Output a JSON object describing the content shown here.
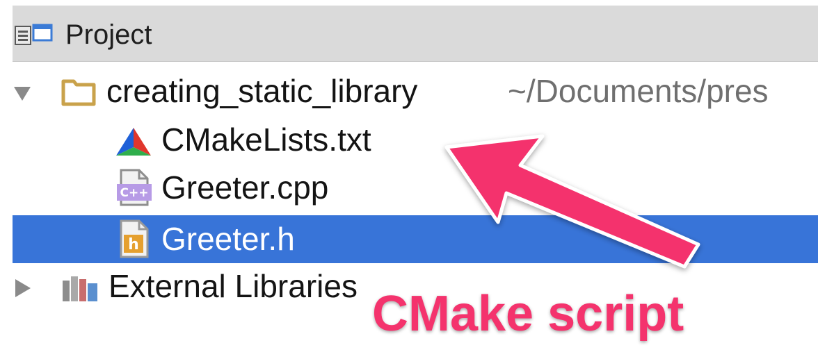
{
  "toolbar": {
    "title": "Project",
    "icon": "project-window-icon"
  },
  "tree": {
    "root": {
      "name": "creating_static_library",
      "path": "~/Documents/pres",
      "expanded": true,
      "icon": "folder-icon"
    },
    "files": [
      {
        "name": "CMakeLists.txt",
        "icon": "cmake-icon",
        "selected": false
      },
      {
        "name": "Greeter.cpp",
        "icon": "cpp-file-icon",
        "selected": false
      },
      {
        "name": "Greeter.h",
        "icon": "header-file-icon",
        "selected": true
      }
    ],
    "external": {
      "name": "External Libraries",
      "expanded": false,
      "icon": "libraries-icon"
    }
  },
  "annotation": {
    "text": "CMake script",
    "color": "#f4336d"
  },
  "colors": {
    "selection": "#3874d8",
    "folder": "#c9a24b",
    "toolbar": "#dadada"
  }
}
